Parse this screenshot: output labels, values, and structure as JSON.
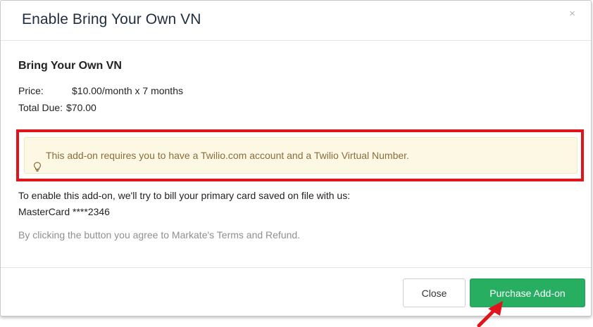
{
  "modal": {
    "title": "Enable Bring Your Own VN",
    "close_glyph": "×"
  },
  "body": {
    "addon_name": "Bring Your Own VN",
    "price_label": "Price:",
    "price_value": "$10.00/month x 7 months",
    "total_label": "Total Due:",
    "total_value": "$70.00",
    "notice_icon": "lightbulb-icon",
    "notice_text": "This add-on requires you to have a Twilio.com account and a Twilio Virtual Number.",
    "billing_line": "To enable this add-on, we'll try to bill your primary card saved on file with us:",
    "card": "MasterCard ****2346",
    "terms": "By clicking the button you agree to Markate's Terms and Refund."
  },
  "footer": {
    "close_label": "Close",
    "purchase_label": "Purchase Add-on"
  },
  "colors": {
    "highlight_border": "#e0141b",
    "notice_bg": "#fcf8e3",
    "notice_text": "#8a6d3b",
    "primary_button": "#27ae60",
    "annotation_arrow": "#e0141b"
  }
}
